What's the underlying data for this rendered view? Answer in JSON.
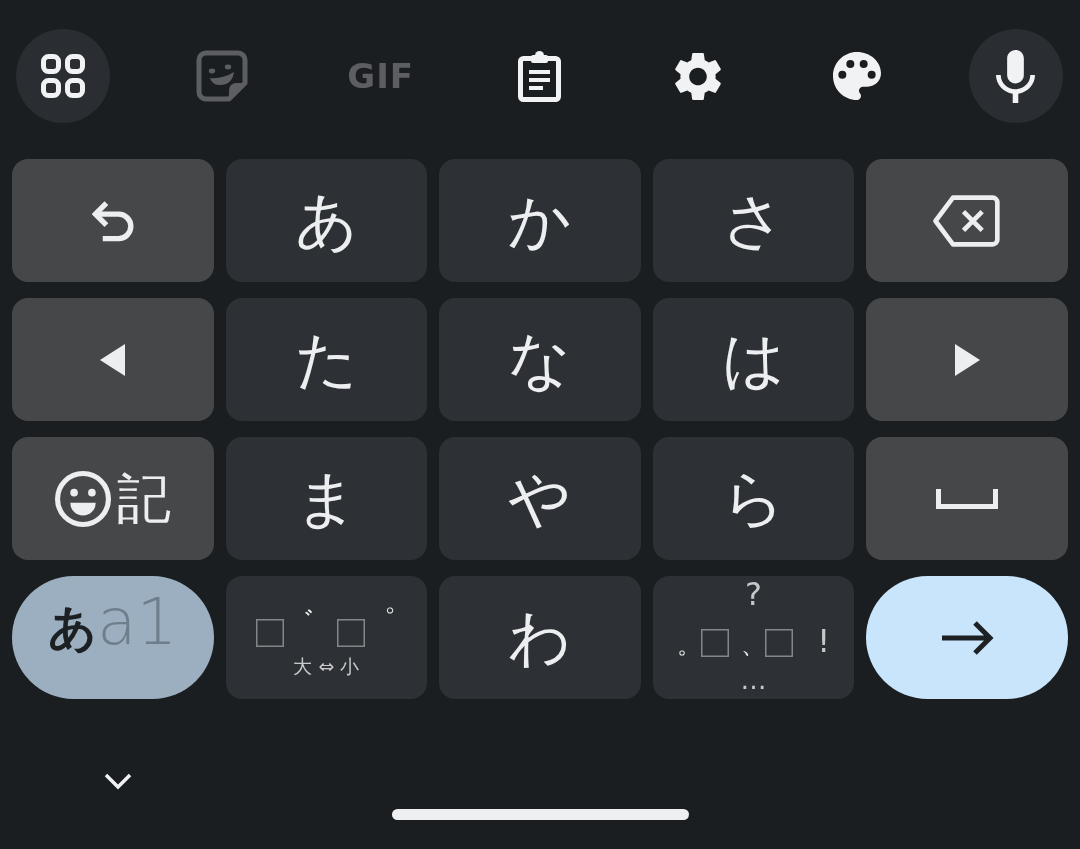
{
  "toolbar": [
    {
      "kind": "apps",
      "circled": true,
      "disabled": false
    },
    {
      "kind": "sticker",
      "circled": false,
      "disabled": true
    },
    {
      "kind": "gif",
      "label": "GIF",
      "circled": false,
      "disabled": true
    },
    {
      "kind": "clipboard",
      "circled": false,
      "disabled": false
    },
    {
      "kind": "settings",
      "circled": false,
      "disabled": false
    },
    {
      "kind": "palette",
      "circled": false,
      "disabled": false
    },
    {
      "kind": "mic",
      "circled": true,
      "disabled": false
    }
  ],
  "keyboard": {
    "rows": [
      [
        {
          "kind": "undo"
        },
        {
          "kind": "kana",
          "label": "あ"
        },
        {
          "kind": "kana",
          "label": "か"
        },
        {
          "kind": "kana",
          "label": "さ"
        },
        {
          "kind": "backspace"
        }
      ],
      [
        {
          "kind": "cursor-left"
        },
        {
          "kind": "kana",
          "label": "た"
        },
        {
          "kind": "kana",
          "label": "な"
        },
        {
          "kind": "kana",
          "label": "は"
        },
        {
          "kind": "cursor-right"
        }
      ],
      [
        {
          "kind": "emoji-symbols",
          "label": "記"
        },
        {
          "kind": "kana",
          "label": "ま"
        },
        {
          "kind": "kana",
          "label": "や"
        },
        {
          "kind": "kana",
          "label": "ら"
        },
        {
          "kind": "space"
        }
      ],
      [
        {
          "kind": "mode",
          "labels": [
            {
              "text": "あ",
              "selected": true
            },
            {
              "text": "a1",
              "selected": false
            }
          ]
        },
        {
          "kind": "dakuten",
          "marks": [
            "゛",
            "゜"
          ],
          "caption": "大 ⇔ 小"
        },
        {
          "kind": "kana",
          "label": "わ"
        },
        {
          "kind": "punctuation",
          "top": "?",
          "marks": [
            "。",
            "、"
          ],
          "right": "!",
          "bottom": "…"
        },
        {
          "kind": "enter"
        }
      ]
    ]
  }
}
